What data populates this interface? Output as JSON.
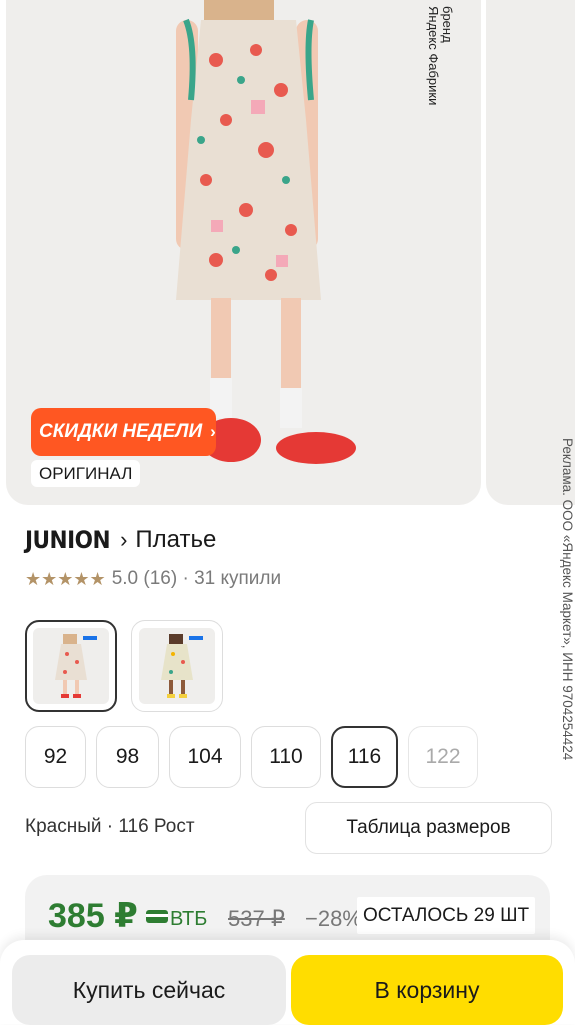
{
  "gallery": {
    "brand_caption": "бренд\nЯндекс Фабрики",
    "promo_badge": "СКИДКИ НЕДЕЛИ",
    "original_badge": "ОРИГИНАЛ"
  },
  "ad_disclaimer": "Реклама. ООО «Яндекс Маркет», ИНН 9704254424",
  "product": {
    "brand": "JUNION",
    "name": "Платье",
    "rating_value": "5.0",
    "reviews": "(16)",
    "bought": "· 31 купили",
    "rating_stars": 5
  },
  "sizes": [
    "92",
    "98",
    "104",
    "110",
    "116",
    "122"
  ],
  "variant_text": "Красный · 116 Рост",
  "size_table_label": "Таблица размеров",
  "pricing": {
    "price": "385 ₽",
    "bank": "ВТБ",
    "old_price": "537 ₽",
    "discount": "−28%",
    "stock": "ОСТАЛОСЬ 29 ШТ"
  },
  "actions": {
    "buy_now": "Купить сейчас",
    "to_cart": "В корзину"
  },
  "colors": {
    "promo": "#ff5722",
    "price": "#2e7d32",
    "cart": "#ffdd00",
    "stars": "#b39367"
  }
}
